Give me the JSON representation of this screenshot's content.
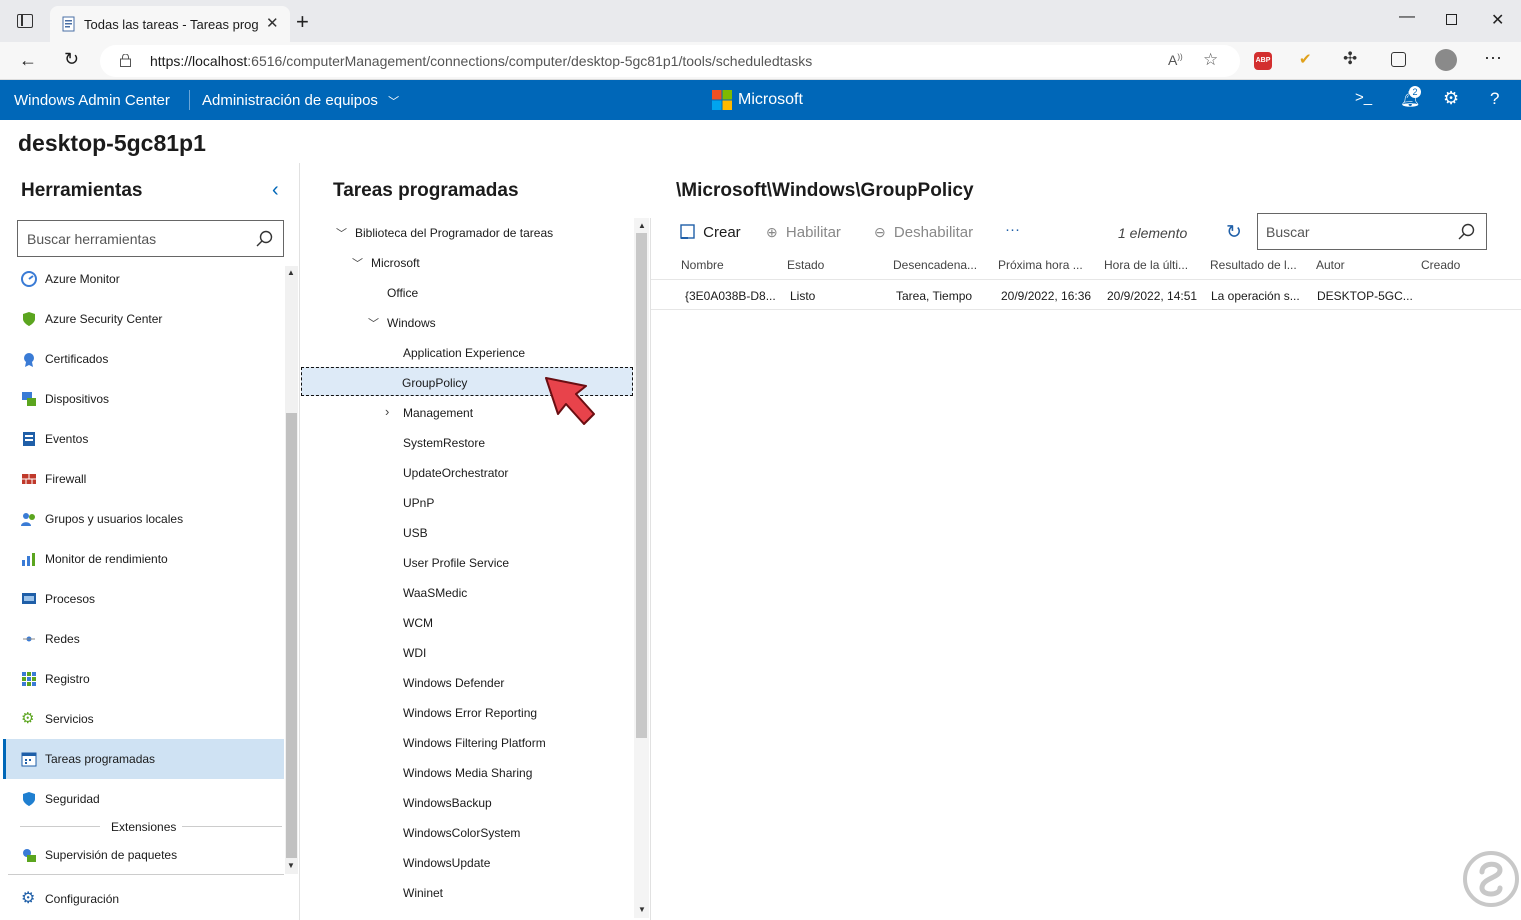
{
  "browser": {
    "tab_title": "Todas las tareas - Tareas program",
    "new_tab": "+",
    "url_host": "https://localhost",
    "url_rest": ":6516/computerManagement/connections/computer/desktop-5gc81p1/tools/scheduledtasks",
    "adblock_label": "ABP",
    "notifications_count": "2"
  },
  "header": {
    "app_name": "Windows Admin Center",
    "section": "Administración de equipos",
    "brand": "Microsoft"
  },
  "page": {
    "hostname": "desktop-5gc81p1"
  },
  "tools": {
    "title": "Herramientas",
    "search_placeholder": "Buscar herramientas",
    "items": [
      "Azure Monitor",
      "Azure Security Center",
      "Certificados",
      "Dispositivos",
      "Eventos",
      "Firewall",
      "Grupos y usuarios locales",
      "Monitor de rendimiento",
      "Procesos",
      "Redes",
      "Registro",
      "Servicios",
      "Tareas programadas",
      "Seguridad"
    ],
    "selected": "Tareas programadas",
    "extensions_label": "Extensiones",
    "extension_items": [
      "Supervisión de paquetes"
    ],
    "settings_label": "Configuración"
  },
  "tree": {
    "title": "Tareas programadas",
    "nodes": [
      "Biblioteca del Programador de tareas",
      "Microsoft",
      "Office",
      "Windows",
      "Application Experience",
      "GroupPolicy",
      "Management",
      "SystemRestore",
      "UpdateOrchestrator",
      "UPnP",
      "USB",
      "User Profile Service",
      "WaaSMedic",
      "WCM",
      "WDI",
      "Windows Defender",
      "Windows Error Reporting",
      "Windows Filtering Platform",
      "Windows Media Sharing",
      "WindowsBackup",
      "WindowsColorSystem",
      "WindowsUpdate",
      "Wininet"
    ],
    "selected": "GroupPolicy"
  },
  "detail": {
    "path": "\\Microsoft\\Windows\\GroupPolicy",
    "toolbar": {
      "create": "Crear",
      "enable": "Habilitar",
      "disable": "Deshabilitar",
      "more": "···",
      "count": "1 elemento",
      "search_placeholder": "Buscar"
    },
    "columns": [
      "Nombre",
      "Estado",
      "Desencadena...",
      "Próxima hora ...",
      "Hora de la últi...",
      "Resultado de l...",
      "Autor",
      "Creado"
    ],
    "rows": [
      [
        "{3E0A038B-D8...",
        "Listo",
        "Tarea, Tiempo",
        "20/9/2022, 16:36",
        "20/9/2022, 14:51",
        "La operación s...",
        "DESKTOP-5GC...",
        ""
      ]
    ]
  },
  "colors": {
    "header_bg": "#0067b8",
    "selection_bg": "#cfe2f3",
    "arrow_red": "#e8434b"
  }
}
